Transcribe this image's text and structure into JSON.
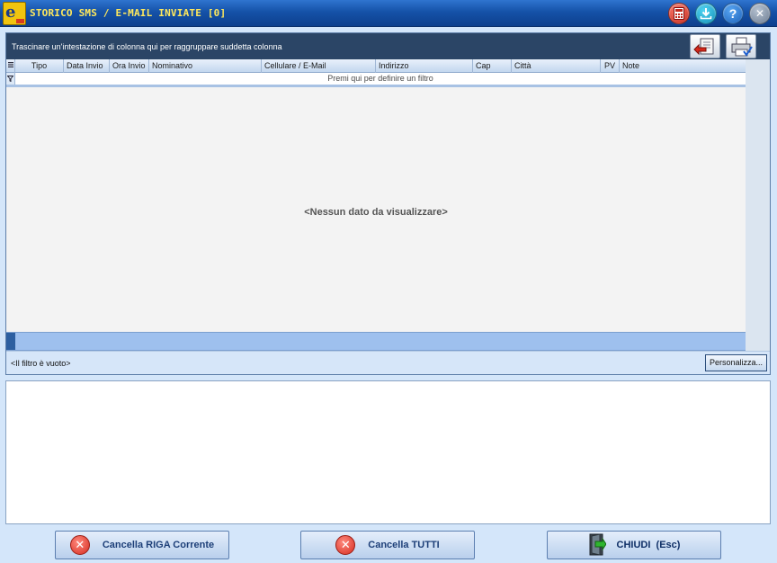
{
  "window": {
    "title": "STORICO SMS / E-MAIL INVIATE [0]"
  },
  "titlebar_buttons": [
    {
      "name": "calculator",
      "icon": "calculator-icon"
    },
    {
      "name": "download",
      "icon": "download-icon"
    },
    {
      "name": "help",
      "icon": "help-icon",
      "glyph": "?"
    },
    {
      "name": "close",
      "icon": "close-icon",
      "glyph": "✕"
    }
  ],
  "grid": {
    "group_prompt": "Trascinare un'intestazione di colonna qui per raggruppare suddetta colonna",
    "columns": [
      "Tipo",
      "Data Invio",
      "Ora Invio",
      "Nominativo",
      "Cellulare / E-Mail",
      "Indirizzo",
      "Cap",
      "Città",
      "PV",
      "Note"
    ],
    "filter_prompt": "Premi qui per definire un filtro",
    "empty_message": "<Nessun dato da visualizzare>",
    "filter_status": "<Il filtro è vuoto>",
    "customize_label": "Personalizza..."
  },
  "buttons": {
    "delete_row": "Cancella RIGA Corrente",
    "delete_all": "Cancella TUTTI",
    "close": "CHIUDI  (Esc)"
  },
  "colors": {
    "title_text": "#ffe85c",
    "group_bar": "#2b4566",
    "accent": "#1d3f78"
  }
}
